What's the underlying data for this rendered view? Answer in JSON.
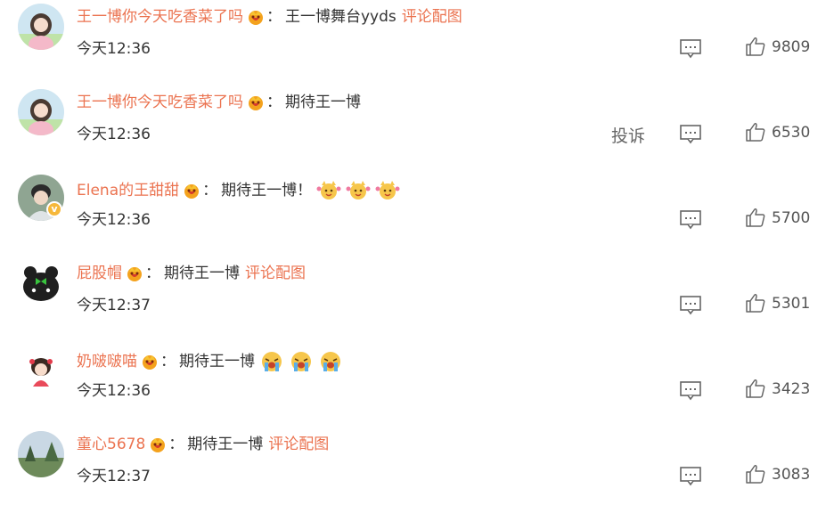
{
  "labels": {
    "colon": "：",
    "pic_link": "评论配图",
    "report": "投诉",
    "verified_badge": "v"
  },
  "icons": {
    "reply": "comment-reply-icon",
    "like": "thumbs-up-icon",
    "vip": "vip-crown-badge-icon"
  },
  "colors": {
    "username": "#eb7350",
    "text": "#333333",
    "icon": "#666666",
    "vip_badge": "#f4a21d"
  },
  "comments": [
    {
      "username": "王一博你今天吃香菜了吗",
      "text": "王一博舞台yyds",
      "has_pic": true,
      "time": "今天12:36",
      "likes": "9809",
      "emoji_count": 0,
      "show_report": false
    },
    {
      "username": "王一博你今天吃香菜了吗",
      "text": "期待王一博",
      "has_pic": false,
      "time": "今天12:36",
      "likes": "6530",
      "emoji_count": 0,
      "show_report": true
    },
    {
      "username": "Elena的王甜甜",
      "text": "期待王一博！",
      "has_pic": false,
      "time": "今天12:36",
      "likes": "5700",
      "emoji_count": 3,
      "show_report": false,
      "verified": true
    },
    {
      "username": "屁股帽",
      "text": "期待王一博",
      "has_pic": true,
      "time": "今天12:37",
      "likes": "5301",
      "emoji_count": 0,
      "show_report": false
    },
    {
      "username": "奶啵啵喵",
      "text": "期待王一博",
      "has_pic": false,
      "time": "今天12:36",
      "likes": "3423",
      "emoji_count": 3,
      "show_report": false
    },
    {
      "username": "童心5678",
      "text": "期待王一博",
      "has_pic": true,
      "time": "今天12:37",
      "likes": "3083",
      "emoji_count": 0,
      "show_report": false
    }
  ]
}
